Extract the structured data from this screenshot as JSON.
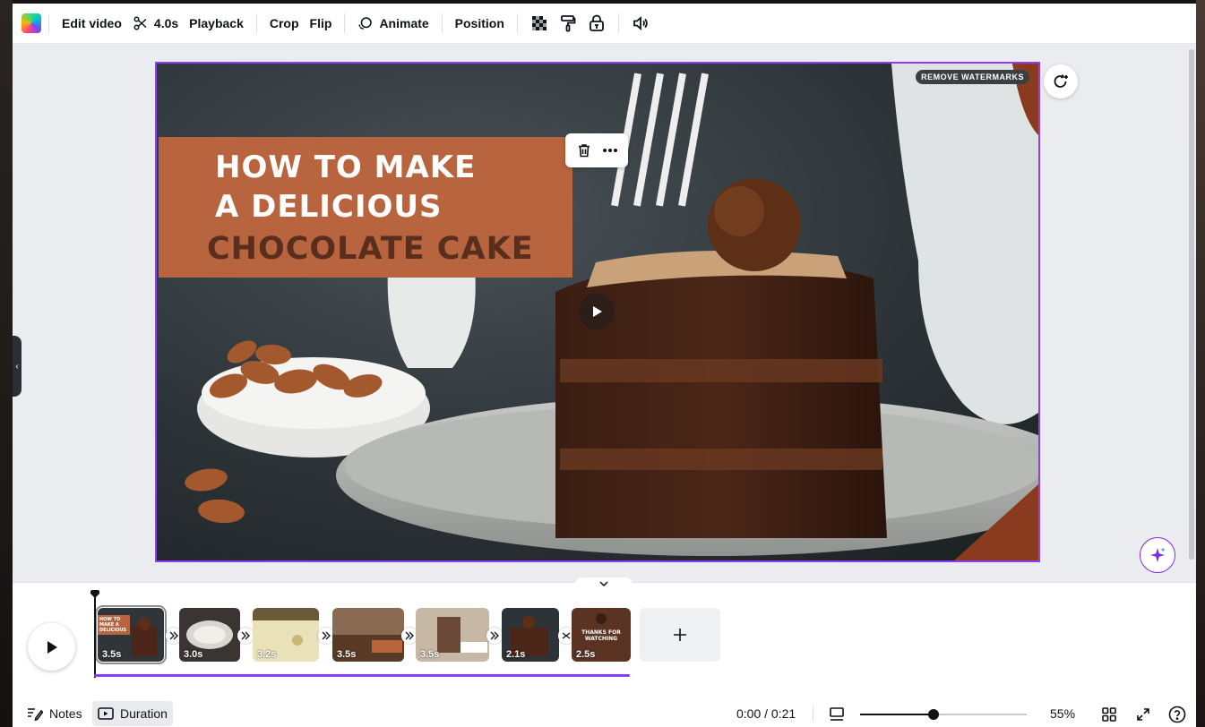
{
  "toolbar": {
    "edit_video": "Edit video",
    "split_duration": "4.0s",
    "playback": "Playback",
    "crop": "Crop",
    "flip": "Flip",
    "animate": "Animate",
    "position": "Position"
  },
  "canvas": {
    "title_line1": "HOW TO MAKE",
    "title_line2": "A DELICIOUS",
    "title_line3": "CHOCOLATE CAKE",
    "watermark_button": "REMOVE WATERMARKS"
  },
  "timeline": {
    "clips": [
      {
        "duration": "3.5s",
        "caption": "HOW TO MAKE A DELICIOUS"
      },
      {
        "duration": "3.0s"
      },
      {
        "duration": "3.2s"
      },
      {
        "duration": "3.5s"
      },
      {
        "duration": "3.5s"
      },
      {
        "duration": "2.1s"
      },
      {
        "duration": "2.5s",
        "caption": "THANKS FOR WATCHING"
      }
    ]
  },
  "footer": {
    "notes": "Notes",
    "duration": "Duration",
    "time": "0:00 / 0:21",
    "zoom_percent": "55%",
    "zoom_level": 0.44
  },
  "colors": {
    "accent": "#8b3dff",
    "title_box": "#b8643f",
    "title_dark_text": "#5a2e1c"
  }
}
